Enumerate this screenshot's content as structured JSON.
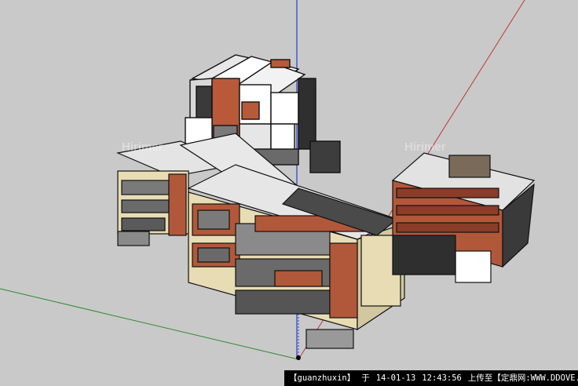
{
  "caption": {
    "user": "【guanzhuxin】",
    "at": "于",
    "date": "14-01-13",
    "time": "12:43:56",
    "upload": "上传至【定鼎网:WWW.DDOVE.COM】"
  },
  "watermarks": [
    "Hirimer",
    "Hirimer"
  ],
  "colors": {
    "background": "#c9c9c9",
    "axis_red": "#c0392b",
    "axis_green": "#2e8b2e",
    "axis_blue": "#1f3fd1",
    "brick": "#b2583a",
    "cream": "#e7dcb3",
    "roof": "#e2e2e2"
  }
}
